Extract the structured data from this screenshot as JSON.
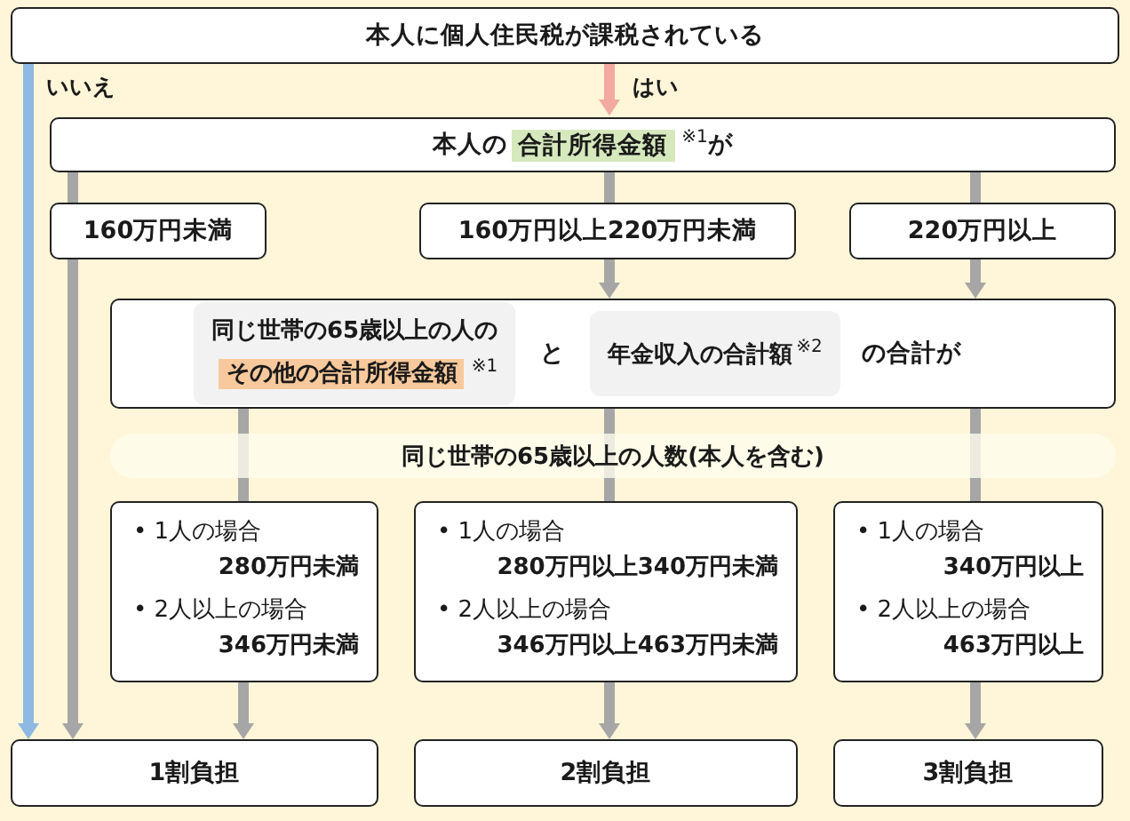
{
  "top_question": "本人に個人住民税が課税されている",
  "no_branch": {
    "label": "いいえ"
  },
  "yes_branch": {
    "label": "はい"
  },
  "income_question": {
    "text_before": "本人の",
    "highlight": "合計所得金額",
    "note": "※1",
    "text_after": "が"
  },
  "income_ranges": [
    "160万円未満",
    "160万円以上220万円未満",
    "220万円以上"
  ],
  "combined_question": {
    "part1_line1": "同じ世帯の65歳以上の人の",
    "part1_highlight": "その他の合計所得金額",
    "part1_note": "※1",
    "connector": "と",
    "part2": "年金収入の合計額",
    "part2_note": "※2",
    "suffix": "の合計が"
  },
  "household_band": "同じ世帯の65歳以上の人数(本人を含む)",
  "thresholds": [
    {
      "cases": [
        {
          "label": "• 1人の場合",
          "amount": "280万円未満"
        },
        {
          "label": "• 2人以上の場合",
          "amount": "346万円未満"
        }
      ]
    },
    {
      "cases": [
        {
          "label": "• 1人の場合",
          "amount": "280万円以上340万円未満"
        },
        {
          "label": "• 2人以上の場合",
          "amount": "346万円以上463万円未満"
        }
      ]
    },
    {
      "cases": [
        {
          "label": "• 1人の場合",
          "amount": "340万円以上"
        },
        {
          "label": "• 2人以上の場合",
          "amount": "463万円以上"
        }
      ]
    }
  ],
  "results": [
    "1割負担",
    "2割負担",
    "3割負担"
  ]
}
